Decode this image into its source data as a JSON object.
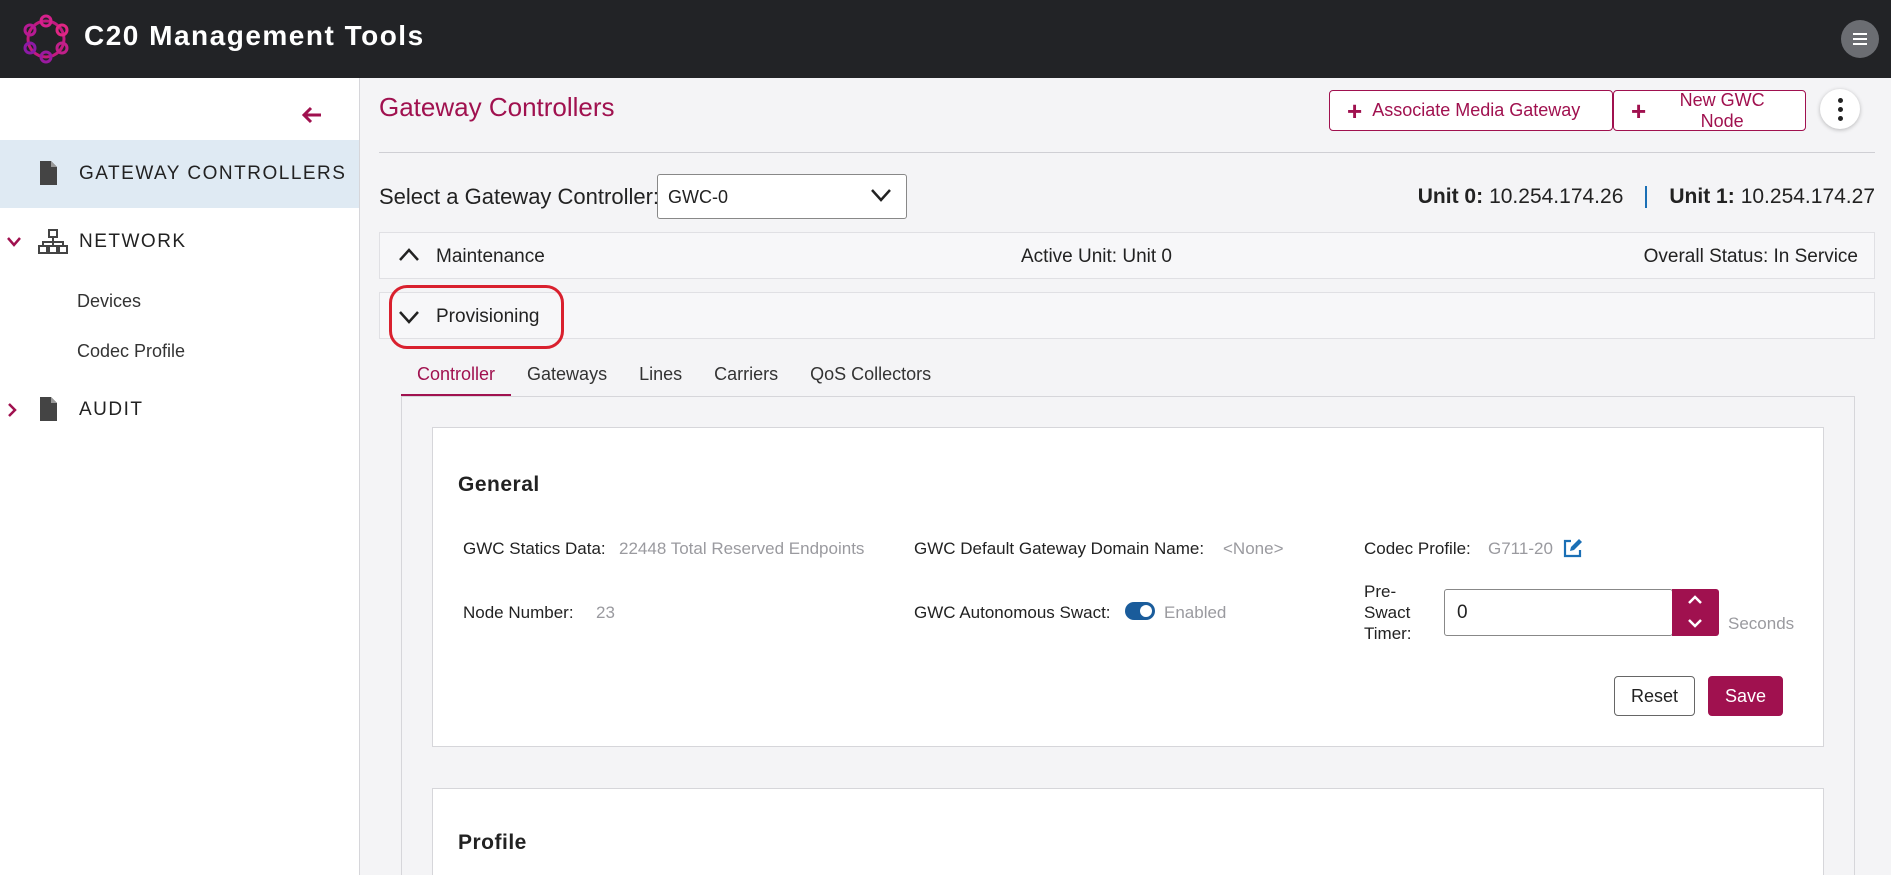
{
  "app": {
    "title": "C20 Management Tools",
    "brand_color": "#a0114f",
    "logo_icon": "chain-ring-logo",
    "menu_icon": "hamburger-icon"
  },
  "sidebar": {
    "collapse_icon": "arrow-left-icon",
    "items": [
      {
        "label": "GATEWAY CONTROLLERS",
        "icon": "document-icon",
        "active": true
      },
      {
        "label": "NETWORK",
        "icon": "network-icon",
        "expanded": true,
        "children": [
          "Devices",
          "Codec Profile"
        ]
      },
      {
        "label": "AUDIT",
        "icon": "document-icon",
        "expanded": false
      }
    ]
  },
  "header": {
    "title": "Gateway Controllers",
    "buttons": {
      "associate": "Associate Media Gateway",
      "new_node": "New GWC Node"
    }
  },
  "selector": {
    "label": "Select a Gateway Controller:",
    "value": "GWC-0"
  },
  "units": {
    "unit0_label": "Unit 0:",
    "unit0_ip": "10.254.174.26",
    "unit1_label": "Unit 1:",
    "unit1_ip": "10.254.174.27"
  },
  "maintenance": {
    "title": "Maintenance",
    "active_unit": "Active Unit: Unit 0",
    "status": "Overall Status: In Service"
  },
  "provisioning": {
    "title": "Provisioning",
    "tabs": [
      "Controller",
      "Gateways",
      "Lines",
      "Carriers",
      "QoS Collectors"
    ],
    "active_tab": "Controller"
  },
  "general": {
    "title": "General",
    "statics_label": "GWC Statics Data:",
    "statics_value": "22448 Total Reserved Endpoints",
    "domain_label": "GWC Default Gateway Domain Name:",
    "domain_value": "<None>",
    "codec_label": "Codec Profile:",
    "codec_value": "G711-20",
    "node_label": "Node Number:",
    "node_value": "23",
    "swact_label": "GWC Autonomous Swact:",
    "swact_value": "Enabled",
    "swact_on": true,
    "timer_label_1": "Pre-",
    "timer_label_2": "Swact",
    "timer_label_3": "Timer:",
    "timer_value": "0",
    "timer_unit": "Seconds",
    "reset": "Reset",
    "save": "Save"
  },
  "profile": {
    "title": "Profile"
  }
}
